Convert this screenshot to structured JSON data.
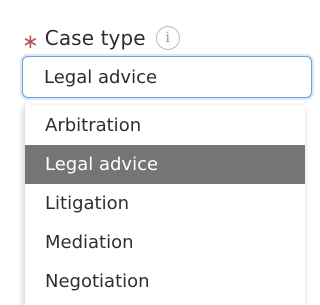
{
  "field": {
    "required_marker": "∗",
    "label": "Case type",
    "info_icon_glyph": "i",
    "selected_value": "Legal advice"
  },
  "dropdown": {
    "options": [
      {
        "label": "Arbitration",
        "selected": false
      },
      {
        "label": "Legal advice",
        "selected": true
      },
      {
        "label": "Litigation",
        "selected": false
      },
      {
        "label": "Mediation",
        "selected": false
      },
      {
        "label": "Negotiation",
        "selected": false
      }
    ]
  },
  "colors": {
    "required": "#c0504d",
    "focus_border": "#6aa4d6",
    "selected_bg": "#757575",
    "selected_text": "#ffffff"
  }
}
